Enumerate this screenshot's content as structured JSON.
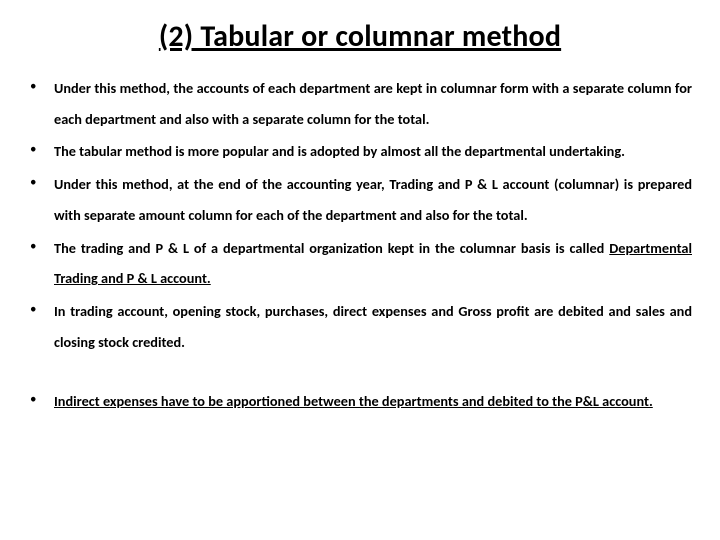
{
  "title": "(2) Tabular or columnar method",
  "bullets": {
    "b1a": "Under this method, the accounts of each department are kept in columnar form with a separate column for each department and also with a separate column for the total.",
    "b2a": "The tabular method is more popular and is adopted by almost all the departmental undertaking.",
    "b3a": "Under this method, at the end of the accounting year, ",
    "b3b": "Trading and P & L account (columnar) is",
    "b3c": " prepared with separate amount column for each of the department and also for the total.",
    "b4a": "The trading and P & L of a departmental organization kept in the columnar basis is called ",
    "b4b": "Departmental Trading and P & L account.",
    "b5a": " In trading account, ",
    "b5b": "opening stock, purchases, direct expenses",
    "b5c": " and Gross profit are debited and sales and closing stock credited.",
    "b6a": " ",
    "b6b": "Indirect expenses have to be apportioned between the departments and debited to the P&L account."
  }
}
